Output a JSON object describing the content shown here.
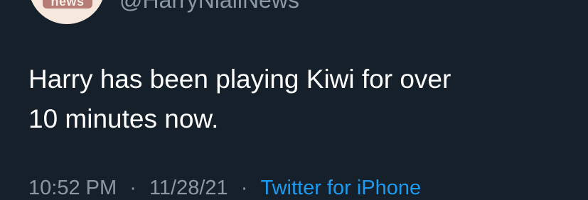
{
  "tweet": {
    "author": {
      "avatar_label": "news",
      "handle": "@HarryNiallNews"
    },
    "text": "Harry has been playing Kiwi for over\n10 minutes now.",
    "meta": {
      "time": "10:52 PM",
      "separator": "·",
      "date": "11/28/21",
      "source": "Twitter for iPhone"
    }
  },
  "colors": {
    "background": "#15202b",
    "text": "#ffffff",
    "muted": "#8b98a5",
    "link": "#1d9bf0"
  }
}
